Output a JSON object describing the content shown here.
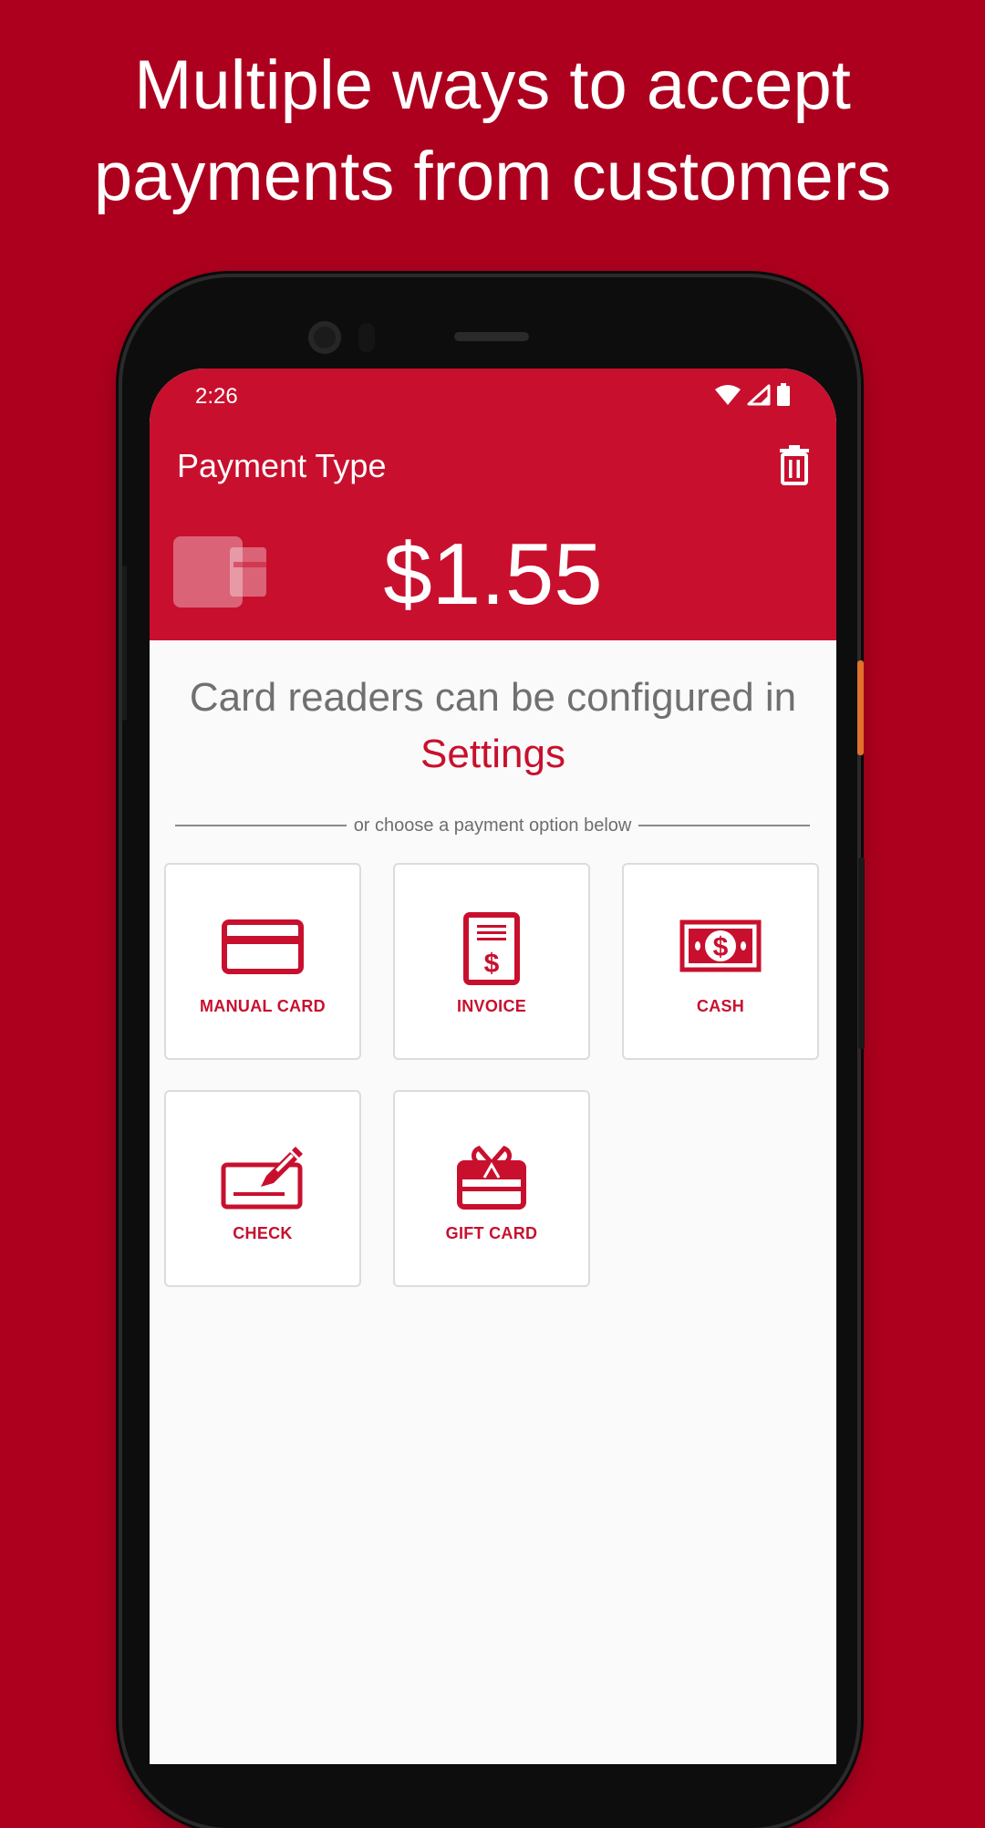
{
  "headline": {
    "line1": "Multiple ways to accept",
    "line2": "payments from customers"
  },
  "status_bar": {
    "time": "2:26"
  },
  "app_bar": {
    "title": "Payment Type",
    "amount": "$1.55"
  },
  "config_note": {
    "text": "Card readers can be configured in",
    "link": "Settings"
  },
  "divider_text": "or choose a payment option below",
  "payment_options": [
    {
      "label": "MANUAL CARD",
      "icon": "credit-card-icon"
    },
    {
      "label": "INVOICE",
      "icon": "invoice-icon"
    },
    {
      "label": "CASH",
      "icon": "cash-icon"
    },
    {
      "label": "CHECK",
      "icon": "check-icon"
    },
    {
      "label": "GIFT CARD",
      "icon": "gift-card-icon"
    }
  ],
  "colors": {
    "background": "#ad001e",
    "brand_red": "#c8102e",
    "screen_bg": "#fafafa",
    "text_gray": "#707070"
  }
}
